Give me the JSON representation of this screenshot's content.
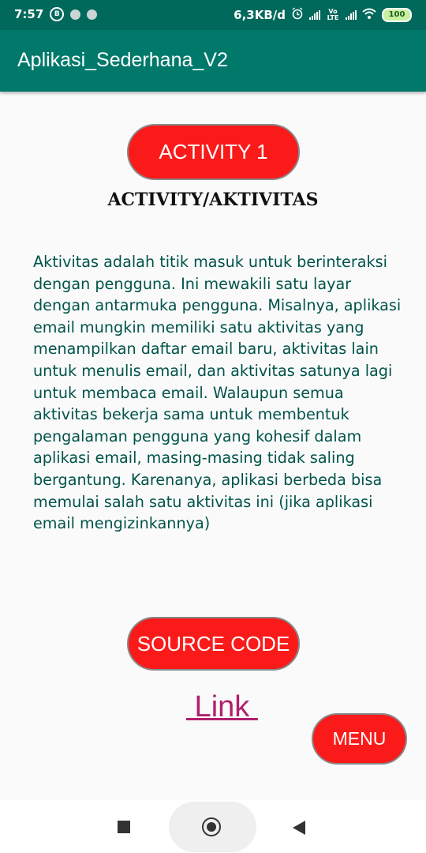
{
  "status_bar": {
    "time": "7:57",
    "b_icon_label": "B",
    "network_speed": "6,3KB/d",
    "lte_label": "Vo LTE",
    "battery_level": "100"
  },
  "app_bar": {
    "title": "Aplikasi_Sederhana_V2"
  },
  "main": {
    "activity_button_label": "ACTIVITY 1",
    "heading": "ACTIVITY/AKTIVITAS",
    "paragraph": "Aktivitas adalah titik masuk untuk berinteraksi dengan pengguna. Ini mewakili satu layar dengan antarmuka pengguna. Misalnya, aplikasi email mungkin memiliki satu aktivitas yang menampilkan daftar email baru, aktivitas lain untuk menulis email, dan aktivitas satunya lagi untuk membaca email. Walaupun semua aktivitas bekerja sama untuk membentuk pengalaman pengguna yang kohesif dalam aplikasi email, masing-masing tidak saling bergantung. Karenanya, aplikasi berbeda bisa memulai salah satu aktivitas ini (jika aplikasi email mengizinkannya)",
    "source_code_button_label": "SOURCE CODE",
    "link_label": " Link ",
    "menu_button_label": "MENU"
  },
  "colors": {
    "status_bar": "#00695c",
    "app_bar": "#00796b",
    "button_red": "#fb1a1a",
    "paragraph_text": "#00534a",
    "link": "#b0206e"
  },
  "icons": {
    "status": [
      "b-circle-icon",
      "dot-icon",
      "dot-icon",
      "alarm-icon",
      "signal-icon",
      "signal-icon",
      "wifi-icon",
      "battery-icon"
    ],
    "nav": [
      "recents-square-icon",
      "home-circle-icon",
      "back-triangle-icon"
    ]
  }
}
